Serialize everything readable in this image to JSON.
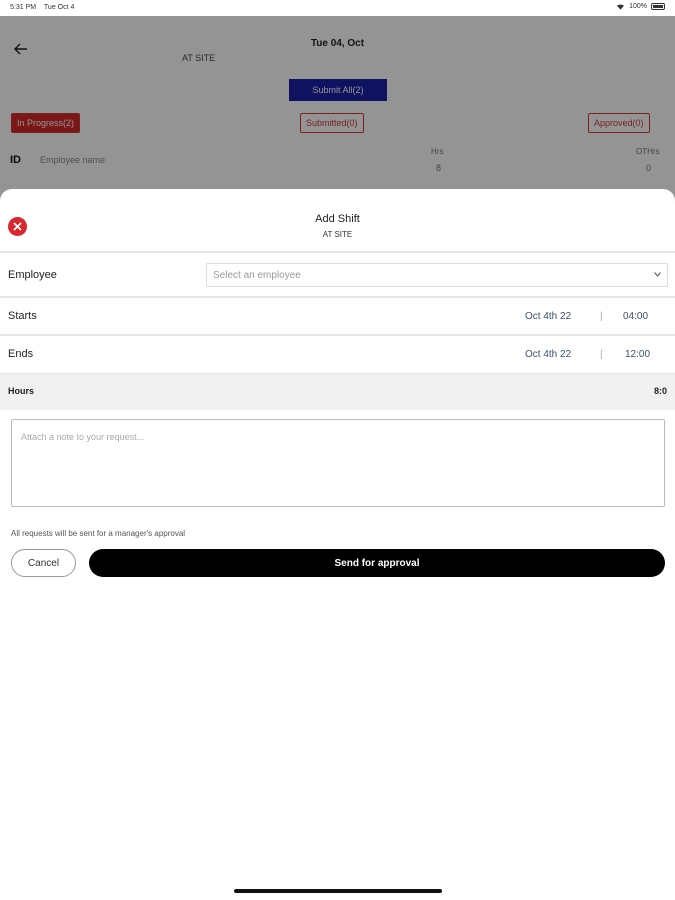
{
  "status_bar": {
    "time": "5:31 PM",
    "date": "Tue Oct 4",
    "battery": "100%",
    "wifi_icon": "wifi-icon",
    "battery_icon": "battery-icon"
  },
  "background": {
    "back_icon": "arrow-left-icon",
    "date_title": "Tue 04, Oct",
    "site": "AT SITE",
    "submit_all": "Submit All(2)",
    "tabs": [
      {
        "label": "In Progress(2)",
        "active": true
      },
      {
        "label": "Submitted(0)",
        "active": false
      },
      {
        "label": "Approved(0)",
        "active": false
      }
    ],
    "table_header": {
      "id": "ID",
      "name": "Employee name",
      "hrs": "Hrs",
      "hrs_value": "8",
      "oth": "OTHrs",
      "oth_value": "0"
    }
  },
  "sheet": {
    "close_icon": "close-icon",
    "title": "Add Shift",
    "subtitle": "AT SITE",
    "employee": {
      "label": "Employee",
      "placeholder": "Select an employee"
    },
    "starts": {
      "label": "Starts",
      "date": "Oct 4th 22",
      "separator": "|",
      "time": "04:00"
    },
    "ends": {
      "label": "Ends",
      "date": "Oct 4th 22",
      "separator": "|",
      "time": "12:00"
    },
    "hours": {
      "label": "Hours",
      "value": "8:0"
    },
    "note_placeholder": "Attach a note to your request...",
    "disclaimer": "All requests will be sent for a manager's approval",
    "cancel_label": "Cancel",
    "send_label": "Send for approval"
  },
  "colors": {
    "submit_all_bg": "#1a1fa6",
    "active_tab_bg": "#d62828",
    "close_icon_bg": "#d9272e",
    "send_button_bg": "#000000"
  }
}
